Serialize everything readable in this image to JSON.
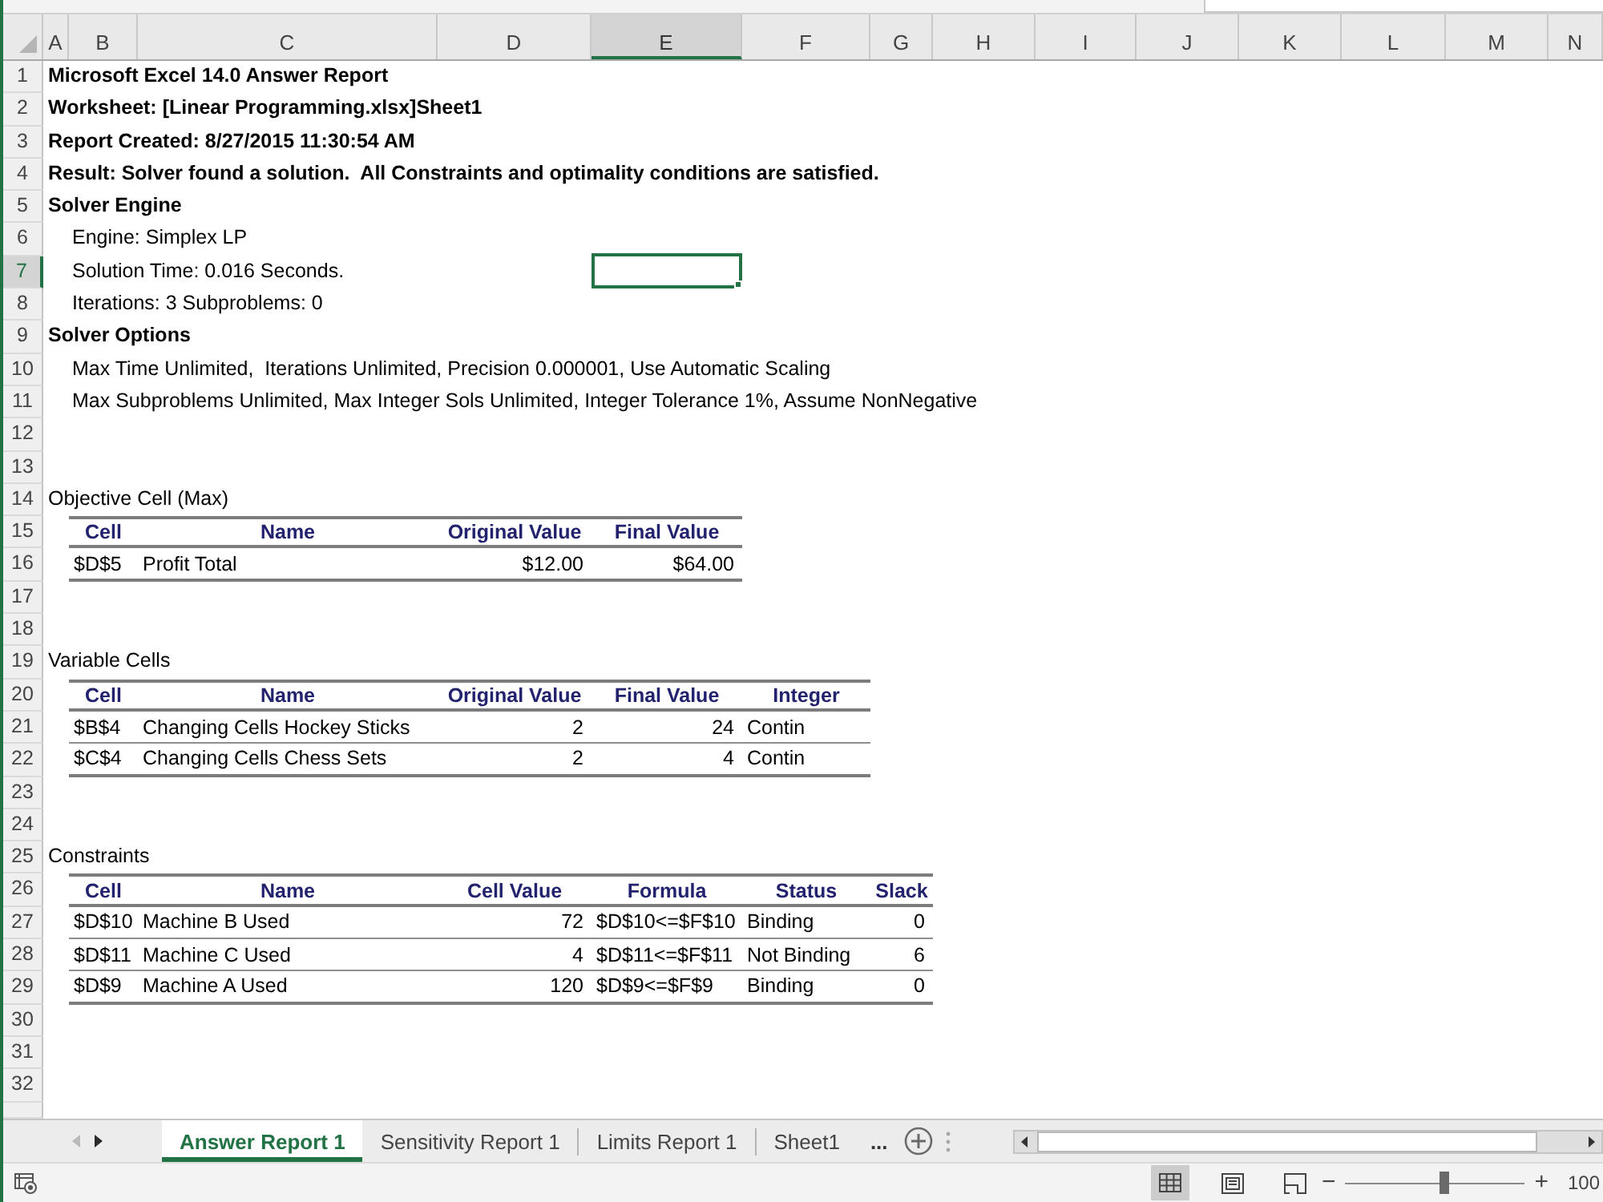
{
  "columns": [
    {
      "label": "A",
      "selected": false
    },
    {
      "label": "B",
      "selected": false
    },
    {
      "label": "C",
      "selected": false
    },
    {
      "label": "D",
      "selected": false
    },
    {
      "label": "E",
      "selected": true
    },
    {
      "label": "F",
      "selected": false
    },
    {
      "label": "G",
      "selected": false
    },
    {
      "label": "H",
      "selected": false
    },
    {
      "label": "I",
      "selected": false
    },
    {
      "label": "J",
      "selected": false
    },
    {
      "label": "K",
      "selected": false
    },
    {
      "label": "L",
      "selected": false
    },
    {
      "label": "M",
      "selected": false
    },
    {
      "label": "N",
      "selected": false
    }
  ],
  "rows": [
    {
      "number": "1",
      "selected": false,
      "kind": "bold",
      "text": "Microsoft Excel 14.0 Answer Report"
    },
    {
      "number": "2",
      "selected": false,
      "kind": "bold",
      "text": "Worksheet: [Linear Programming.xlsx]Sheet1"
    },
    {
      "number": "3",
      "selected": false,
      "kind": "bold",
      "text": "Report Created: 8/27/2015 11:30:54 AM"
    },
    {
      "number": "4",
      "selected": false,
      "kind": "bold",
      "text": "Result: Solver found a solution.  All Constraints and optimality conditions are satisfied."
    },
    {
      "number": "5",
      "selected": false,
      "kind": "bold",
      "text": "Solver Engine"
    },
    {
      "number": "6",
      "selected": false,
      "kind": "indented",
      "text": "Engine: Simplex LP"
    },
    {
      "number": "7",
      "selected": true,
      "kind": "indented",
      "text": "Solution Time: 0.016 Seconds."
    },
    {
      "number": "8",
      "selected": false,
      "kind": "indented",
      "text": "Iterations: 3 Subproblems: 0"
    },
    {
      "number": "9",
      "selected": false,
      "kind": "bold",
      "text": "Solver Options"
    },
    {
      "number": "10",
      "selected": false,
      "kind": "indented",
      "text": "Max Time Unlimited,  Iterations Unlimited, Precision 0.000001, Use Automatic Scaling"
    },
    {
      "number": "11",
      "selected": false,
      "kind": "indented",
      "text": "Max Subproblems Unlimited, Max Integer Sols Unlimited, Integer Tolerance 1%, Assume NonNegative"
    },
    {
      "number": "12",
      "selected": false
    },
    {
      "number": "13",
      "selected": false
    },
    {
      "number": "14",
      "selected": false,
      "kind": "caption",
      "text": "Objective Cell (Max)"
    },
    {
      "number": "15",
      "selected": false,
      "kind": "table-head",
      "cells": [
        "Cell",
        "Name",
        "Original Value",
        "Final Value"
      ]
    },
    {
      "number": "16",
      "selected": false,
      "kind": "table-row",
      "cells": [
        {
          "text": "$D$5",
          "kind": "text"
        },
        {
          "text": "Profit Total",
          "kind": "text"
        },
        {
          "text": "$12.00",
          "kind": "number"
        },
        {
          "text": "$64.00",
          "kind": "number"
        }
      ]
    },
    {
      "number": "17",
      "selected": false
    },
    {
      "number": "18",
      "selected": false
    },
    {
      "number": "19",
      "selected": false,
      "kind": "caption",
      "text": "Variable Cells"
    },
    {
      "number": "20",
      "selected": false,
      "kind": "table-head",
      "cells": [
        "Cell",
        "Name",
        "Original Value",
        "Final Value",
        "Integer"
      ]
    },
    {
      "number": "21",
      "selected": false,
      "kind": "table-row",
      "cells": [
        {
          "text": "$B$4",
          "kind": "text"
        },
        {
          "text": "Changing Cells Hockey Sticks",
          "kind": "text"
        },
        {
          "text": "2",
          "kind": "number"
        },
        {
          "text": "24",
          "kind": "number"
        },
        {
          "text": "Contin",
          "kind": "text"
        }
      ]
    },
    {
      "number": "22",
      "selected": false,
      "kind": "table-row",
      "cells": [
        {
          "text": "$C$4",
          "kind": "text"
        },
        {
          "text": "Changing Cells Chess Sets",
          "kind": "text"
        },
        {
          "text": "2",
          "kind": "number"
        },
        {
          "text": "4",
          "kind": "number"
        },
        {
          "text": "Contin",
          "kind": "text"
        }
      ]
    },
    {
      "number": "23",
      "selected": false
    },
    {
      "number": "24",
      "selected": false
    },
    {
      "number": "25",
      "selected": false,
      "kind": "caption",
      "text": "Constraints"
    },
    {
      "number": "26",
      "selected": false,
      "kind": "table-head",
      "cells": [
        "Cell",
        "Name",
        "Cell Value",
        "Formula",
        "Status",
        "Slack"
      ]
    },
    {
      "number": "27",
      "selected": false,
      "kind": "table-row",
      "cells": [
        {
          "text": "$D$10",
          "kind": "text"
        },
        {
          "text": "Machine B Used",
          "kind": "text"
        },
        {
          "text": "72",
          "kind": "number"
        },
        {
          "text": "$D$10<=$F$10",
          "kind": "text"
        },
        {
          "text": "Binding",
          "kind": "text"
        },
        {
          "text": "0",
          "kind": "number"
        }
      ]
    },
    {
      "number": "28",
      "selected": false,
      "kind": "table-row",
      "cells": [
        {
          "text": "$D$11",
          "kind": "text"
        },
        {
          "text": "Machine C Used",
          "kind": "text"
        },
        {
          "text": "4",
          "kind": "number"
        },
        {
          "text": "$D$11<=$F$11",
          "kind": "text"
        },
        {
          "text": "Not Binding",
          "kind": "text"
        },
        {
          "text": "6",
          "kind": "number"
        }
      ]
    },
    {
      "number": "29",
      "selected": false,
      "kind": "table-row",
      "cells": [
        {
          "text": "$D$9",
          "kind": "text"
        },
        {
          "text": "Machine A Used",
          "kind": "text"
        },
        {
          "text": "120",
          "kind": "number"
        },
        {
          "text": "$D$9<=$F$9",
          "kind": "text"
        },
        {
          "text": "Binding",
          "kind": "text"
        },
        {
          "text": "0",
          "kind": "number"
        }
      ]
    },
    {
      "number": "30",
      "selected": false
    },
    {
      "number": "31",
      "selected": false
    },
    {
      "number": "32",
      "selected": false
    }
  ],
  "sheet_nav": [
    {
      "kind": "previous",
      "disabled": true
    },
    {
      "kind": "next",
      "disabled": false
    }
  ],
  "sheet_tabs": [
    {
      "label": "Answer Report 1",
      "selected": true
    },
    {
      "label": "Sensitivity Report 1",
      "selected": false
    },
    {
      "label": "Limits Report 1",
      "selected": false
    },
    {
      "label": "Sheet1",
      "selected": false
    }
  ],
  "more_tabs": "...",
  "status_bar": {
    "views": [
      {
        "kind": "normal",
        "selected": true
      },
      {
        "kind": "page-layout",
        "selected": false
      },
      {
        "kind": "page-break",
        "selected": false
      }
    ],
    "zoom": {
      "minus": "−",
      "plus": "+",
      "level": 0.55,
      "reading": "100"
    }
  }
}
